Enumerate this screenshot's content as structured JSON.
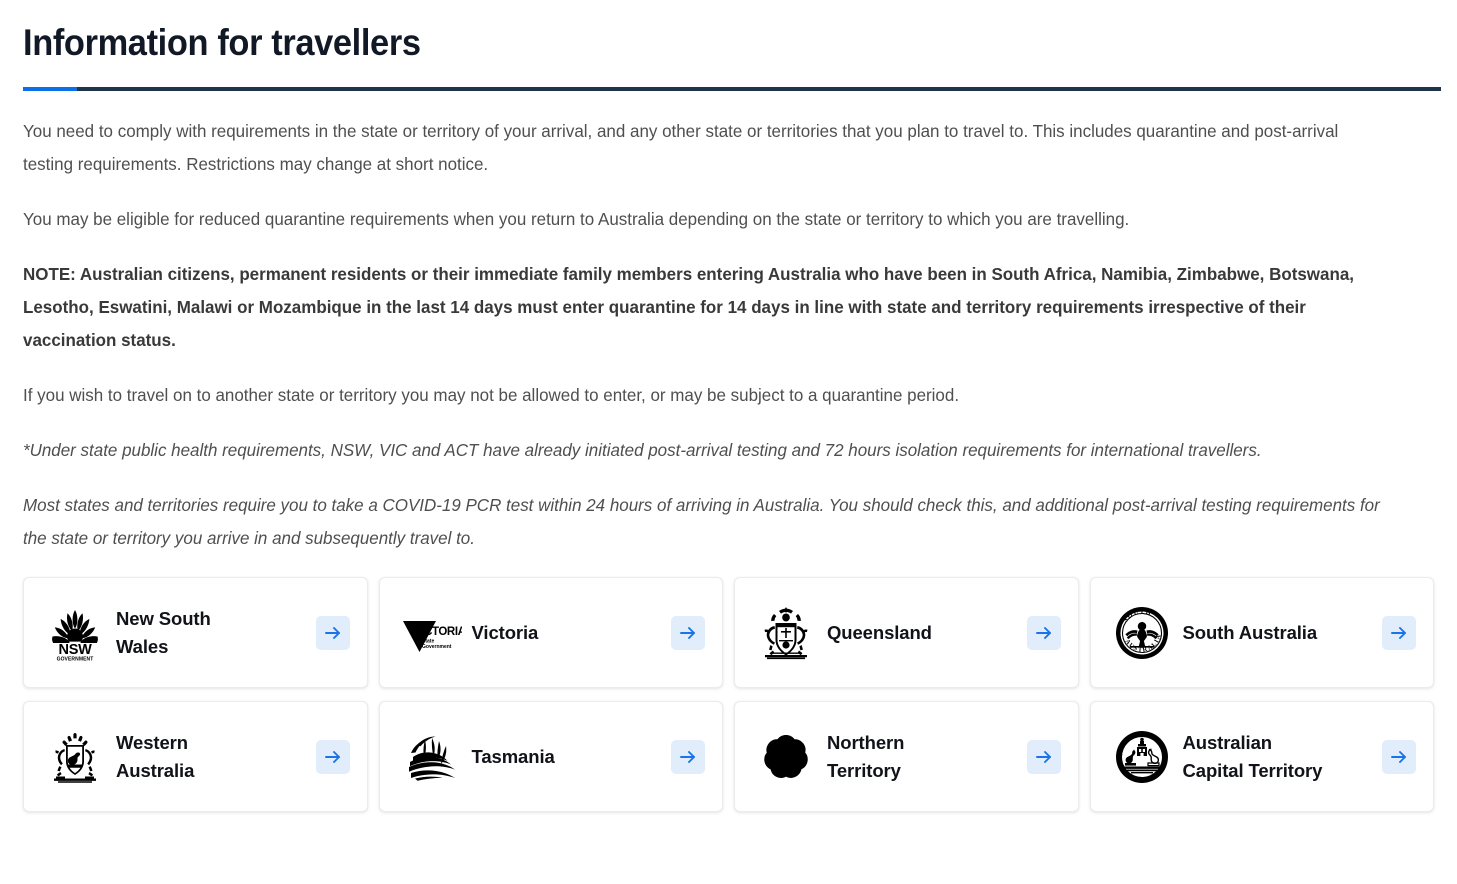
{
  "header": {
    "title": "Information for travellers",
    "rule_accent_color": "#0b6fe8",
    "rule_color": "#1f3449"
  },
  "body": {
    "paragraphs": [
      {
        "style": "normal",
        "text": "You need to comply with requirements in the state or territory of your arrival, and any other state or territories that you plan to travel to. This includes quarantine and post-arrival testing requirements. Restrictions may change at short notice."
      },
      {
        "style": "normal",
        "text": "You may be eligible for reduced quarantine requirements when you return to Australia depending on the state or territory to which you are travelling."
      },
      {
        "style": "bold",
        "text": "NOTE: Australian citizens, permanent residents or their immediate family members entering Australia who have been in South Africa, Namibia, Zimbabwe, Botswana, Lesotho, Eswatini, Malawi or Mozambique in the last 14 days must enter quarantine for 14 days in line with state and territory requirements irrespective of their vaccination status."
      },
      {
        "style": "normal",
        "text": "If you wish to travel on to another state or territory you may not be allowed to enter, or may be subject to a quarantine period."
      },
      {
        "style": "italic",
        "text": "*Under state public health requirements, NSW, VIC and ACT have already initiated post-arrival testing and 72 hours isolation requirements for international travellers."
      },
      {
        "style": "italic",
        "text": "Most states and territories require you to take a COVID-19 PCR test within 24 hours of arriving in Australia. You should check this, and additional post-arrival testing requirements for the state or territory you arrive in and subsequently travel to."
      }
    ]
  },
  "cards": {
    "arrow_bg_color": "#e2edfb",
    "arrow_color": "#1a73e8",
    "items": [
      {
        "label": "New South\nWales",
        "logo": "nsw-waratah-logo",
        "logo_caption": "NSW",
        "logo_subcaption": "GOVERNMENT"
      },
      {
        "label": "Victoria",
        "logo": "victoria-triangle-logo",
        "logo_caption": "VICTORIA",
        "logo_subcaption": "State Government"
      },
      {
        "label": "Queensland",
        "logo": "queensland-coat-of-arms-logo",
        "logo_caption": "",
        "logo_subcaption": ""
      },
      {
        "label": "South Australia",
        "logo": "south-australia-circular-badge-logo",
        "logo_caption": "SOUTH AUSTRALIA",
        "logo_subcaption": ""
      },
      {
        "label": "Western\nAustralia",
        "logo": "western-australia-coat-of-arms-logo",
        "logo_caption": "",
        "logo_subcaption": ""
      },
      {
        "label": "Tasmania",
        "logo": "tasmania-stylised-logo",
        "logo_caption": "",
        "logo_subcaption": ""
      },
      {
        "label": "Northern\nTerritory",
        "logo": "northern-territory-desert-rose-logo",
        "logo_caption": "",
        "logo_subcaption": ""
      },
      {
        "label": "Australian\nCapital Territory",
        "logo": "act-circular-coat-of-arms-logo",
        "logo_caption": "",
        "logo_subcaption": ""
      }
    ]
  }
}
